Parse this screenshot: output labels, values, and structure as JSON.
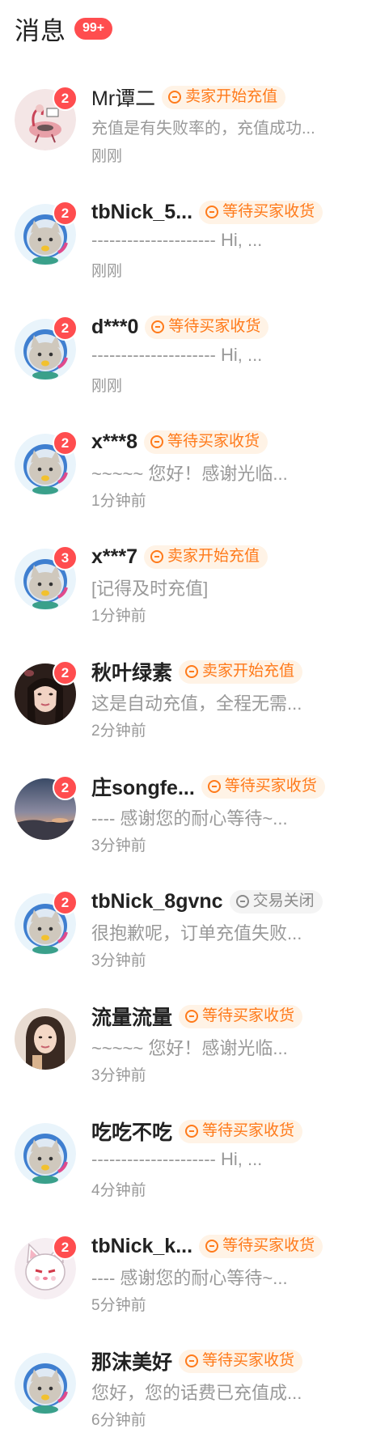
{
  "header": {
    "title": "消息",
    "unread_badge": "99+"
  },
  "colors": {
    "badge": "#ff4d4f",
    "tag_orange_text": "#ff7a1a",
    "tag_orange_bg": "#fff3e6",
    "tag_gray_text": "#8a8a8a",
    "tag_gray_bg": "#f4f4f4",
    "secondary_text": "#999999"
  },
  "conversations": [
    {
      "name": "Mr谭二",
      "badge": "2",
      "status": "卖家开始充值",
      "status_color": "orange",
      "preview": "充值是有失败率的，充值成功...",
      "time": "刚刚",
      "avatar": "flamingo-avatar"
    },
    {
      "name": "tbNick_5...",
      "badge": "2",
      "status": "等待买家收货",
      "status_color": "orange",
      "preview": "--------------------- Hi, ...",
      "time": "刚刚",
      "avatar": "default-cat-avatar"
    },
    {
      "name": "d***0",
      "badge": "2",
      "status": "等待买家收货",
      "status_color": "orange",
      "preview": "--------------------- Hi, ...",
      "time": "刚刚",
      "avatar": "default-cat-avatar"
    },
    {
      "name": "x***8",
      "badge": "2",
      "status": "等待买家收货",
      "status_color": "orange",
      "preview": "~~~~~ 您好！感谢光临...",
      "time": "1分钟前",
      "avatar": "default-cat-avatar"
    },
    {
      "name": "x***7",
      "badge": "3",
      "status": "卖家开始充值",
      "status_color": "orange",
      "preview": "[记得及时充值]",
      "time": "1分钟前",
      "avatar": "default-cat-avatar"
    },
    {
      "name": "秋叶绿素",
      "badge": "2",
      "status": "卖家开始充值",
      "status_color": "orange",
      "preview": "这是自动充值，全程无需...",
      "time": "2分钟前",
      "avatar": "girl-photo-avatar"
    },
    {
      "name": "庄songfe...",
      "badge": "2",
      "status": "等待买家收货",
      "status_color": "orange",
      "preview": "---- 感谢您的耐心等待~...",
      "time": "3分钟前",
      "avatar": "sunset-photo-avatar"
    },
    {
      "name": "tbNick_8gvnc",
      "badge": "2",
      "status": "交易关闭",
      "status_color": "gray",
      "preview": "很抱歉呢，订单充值失败...",
      "time": "3分钟前",
      "avatar": "default-cat-avatar"
    },
    {
      "name": "流量流量",
      "badge": "",
      "status": "等待买家收货",
      "status_color": "orange",
      "preview": "~~~~~ 您好！感谢光临...",
      "time": "3分钟前",
      "avatar": "woman-photo-avatar"
    },
    {
      "name": "吃吃不吃",
      "badge": "",
      "status": "等待买家收货",
      "status_color": "orange",
      "preview": "--------------------- Hi, ...",
      "time": "4分钟前",
      "avatar": "default-cat-avatar"
    },
    {
      "name": "tbNick_k...",
      "badge": "2",
      "status": "等待买家收货",
      "status_color": "orange",
      "preview": "---- 感谢您的耐心等待~...",
      "time": "5分钟前",
      "avatar": "white-cat-avatar"
    },
    {
      "name": "那沫美好",
      "badge": "",
      "status": "等待买家收货",
      "status_color": "orange",
      "preview": "您好，您的话费已充值成...",
      "time": "6分钟前",
      "avatar": "default-cat-avatar"
    }
  ]
}
